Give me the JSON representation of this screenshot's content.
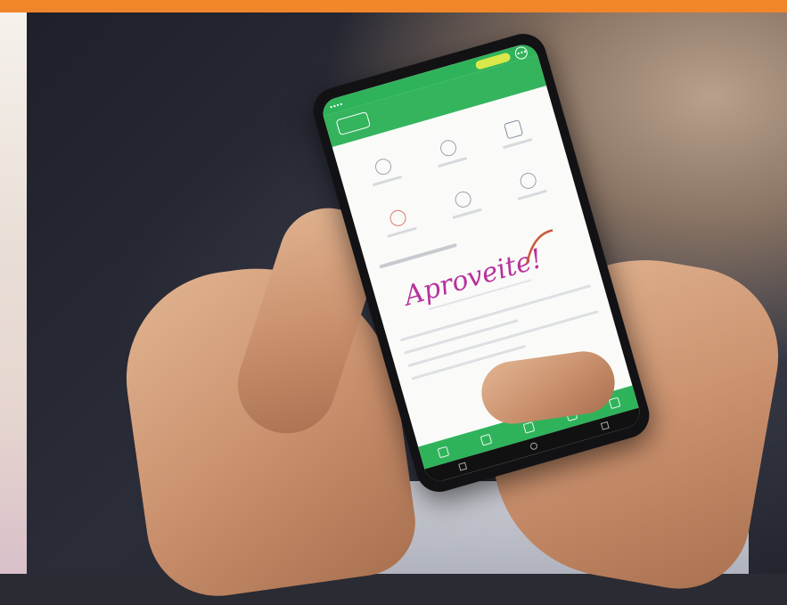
{
  "scene": {
    "description_free": true
  },
  "phone_screen": {
    "handwriting": "Aproveite!",
    "handwriting_color": "#b8329c",
    "accent_color": "#34b45d",
    "highlight_color": "#d9e84b"
  },
  "frame": {
    "border_color": "#f0852a"
  }
}
